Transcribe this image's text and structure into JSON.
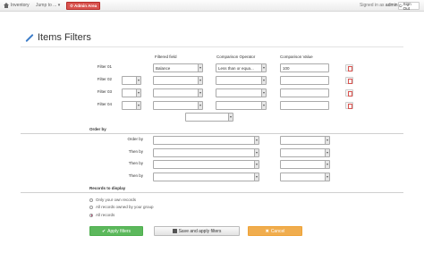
{
  "navbar": {
    "brand": "Inventory",
    "jump_to": "Jump to ...",
    "admin_area": "Admin Area",
    "signed_in_prefix": "Signed in as",
    "username": "admin",
    "sign_out": "Sign Out"
  },
  "page": {
    "title": "Items Filters"
  },
  "headers": {
    "filtered_field": "Filtered field",
    "comparison_operator": "Comparison Operator",
    "comparison_value": "Comparison Value"
  },
  "filters": [
    {
      "label": "Filter 01",
      "field": "Balance",
      "operator": "Less than or equa...",
      "value": "100"
    },
    {
      "label": "Filter 02",
      "field": "",
      "operator": "",
      "value": ""
    },
    {
      "label": "Filter 03",
      "field": "",
      "operator": "",
      "value": ""
    },
    {
      "label": "Filter 04",
      "field": "",
      "operator": "",
      "value": ""
    }
  ],
  "order": {
    "section_title": "Order by",
    "rows": [
      {
        "label": "Order by"
      },
      {
        "label": "Then by"
      },
      {
        "label": "Then by"
      },
      {
        "label": "Then by"
      }
    ]
  },
  "records": {
    "section_title": "Records to display",
    "options": [
      {
        "label": "Only your own records",
        "selected": false
      },
      {
        "label": "All records owned by your group",
        "selected": false
      },
      {
        "label": "All records",
        "selected": true
      }
    ]
  },
  "buttons": {
    "apply": "Apply filters",
    "save_apply": "Save and apply filters",
    "cancel": "Cancel"
  },
  "colors": {
    "admin": "#d9534f",
    "apply": "#5cb85c",
    "cancel": "#f0ad4e"
  }
}
